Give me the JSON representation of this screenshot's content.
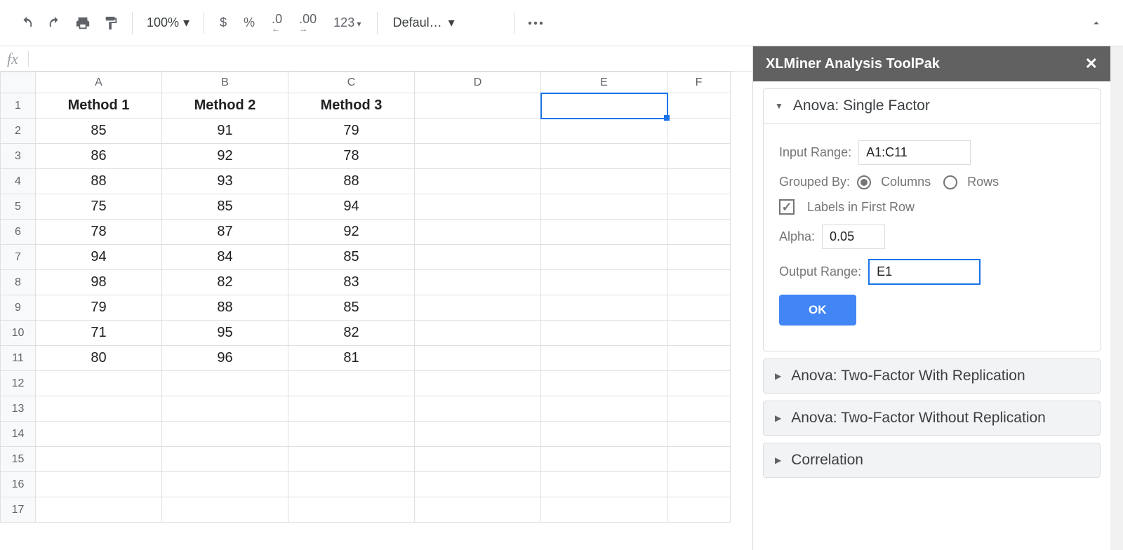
{
  "toolbar": {
    "zoom": "100%",
    "font": "Default (Ari...",
    "fmt_currency": "$",
    "fmt_percent": "%",
    "fmt_dec_dec": ".0",
    "fmt_dec_inc": ".00",
    "fmt_more": "123"
  },
  "formula_bar": {
    "value": ""
  },
  "grid": {
    "columns": [
      "A",
      "B",
      "C",
      "D",
      "E",
      "F"
    ],
    "row_count": 17,
    "headers": [
      "Method 1",
      "Method 2",
      "Method 3"
    ],
    "data": [
      [
        85,
        91,
        79
      ],
      [
        86,
        92,
        78
      ],
      [
        88,
        93,
        88
      ],
      [
        75,
        85,
        94
      ],
      [
        78,
        87,
        92
      ],
      [
        94,
        84,
        85
      ],
      [
        98,
        82,
        83
      ],
      [
        79,
        88,
        85
      ],
      [
        71,
        95,
        82
      ],
      [
        80,
        96,
        81
      ]
    ],
    "selected_cell": "E1"
  },
  "sidebar": {
    "title": "XLMiner Analysis ToolPak",
    "anova_single": {
      "title": "Anova: Single Factor",
      "input_range_label": "Input Range:",
      "input_range": "A1:C11",
      "grouped_by_label": "Grouped By:",
      "grouped_columns": "Columns",
      "grouped_rows": "Rows",
      "labels_first_row": "Labels in First Row",
      "alpha_label": "Alpha:",
      "alpha": "0.05",
      "output_range_label": "Output Range:",
      "output_range": "E1",
      "ok": "OK"
    },
    "other_panels": [
      "Anova: Two-Factor With Replication",
      "Anova: Two-Factor Without Replication",
      "Correlation"
    ]
  }
}
